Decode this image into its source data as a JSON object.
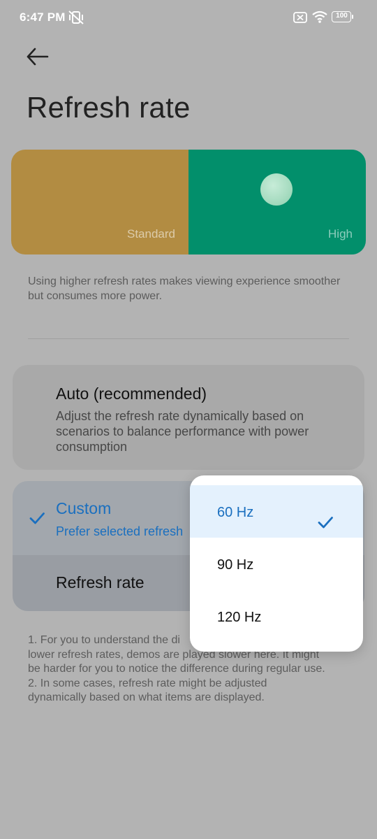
{
  "status_bar": {
    "time": "6:47 PM",
    "battery": "100",
    "icons": [
      "vibrate-off-icon",
      "sim-off-icon",
      "wifi-icon",
      "battery-icon"
    ]
  },
  "header": {
    "back_icon": "arrow-left-icon",
    "title": "Refresh rate"
  },
  "preview": {
    "standard_label": "Standard",
    "high_label": "High",
    "standard_color": "#b28c42",
    "high_color": "#028f6b"
  },
  "description": "Using higher refresh rates makes viewing experience smoother but consumes more power.",
  "options": {
    "auto": {
      "title": "Auto (recommended)",
      "subtitle": "Adjust the refresh rate dynamically based on scenarios to balance performance with power consumption"
    },
    "custom": {
      "title": "Custom",
      "subtitle": "Prefer selected refresh",
      "selected": true,
      "rate_label": "Refresh rate"
    }
  },
  "notes": [
    "1. For you to understand the di",
    "lower refresh rates, demos are played slower here. It might",
    "be harder for you to notice the difference during regular use.",
    "2. In some cases, refresh rate might be adjusted",
    "dynamically based on what items are displayed."
  ],
  "dropdown": {
    "options": [
      {
        "label": "60 Hz",
        "selected": true
      },
      {
        "label": "90 Hz",
        "selected": false
      },
      {
        "label": "120 Hz",
        "selected": false
      }
    ],
    "accent_color": "#1a6fbf"
  }
}
